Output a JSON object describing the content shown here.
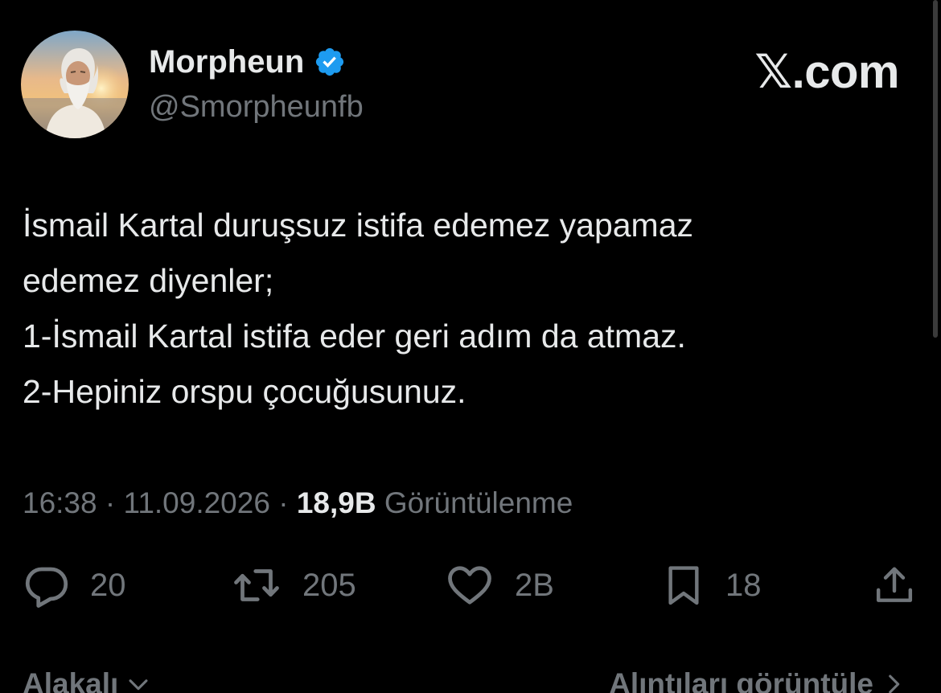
{
  "author": {
    "display_name": "Morpheun",
    "handle": "@Smorpheunfb",
    "verified": true
  },
  "brand": "𝕏.com",
  "tweet": {
    "lines": [
      "İsmail Kartal duruşsuz istifa edemez yapamaz",
      "edemez diyenler;",
      "1-İsmail Kartal istifa eder geri adım da atmaz.",
      "2-Hepiniz orspu çocuğusunuz."
    ]
  },
  "meta": {
    "time": "16:38",
    "separator": "·",
    "date": "11.09.2026",
    "views_count": "18,9B",
    "views_label": "Görüntülenme"
  },
  "actions": {
    "replies": "20",
    "reposts": "205",
    "likes": "2B",
    "bookmarks": "18"
  },
  "bottom": {
    "relevant_label": "Alakalı",
    "quotes_label": "Alıntıları görüntüle"
  },
  "colors": {
    "background": "#000000",
    "primary_text": "#e7e9ea",
    "secondary_text": "#71767b",
    "verified_badge": "#1d9bf0"
  },
  "icons": {
    "verified": "verified-badge-icon",
    "reply": "reply-bubble-icon",
    "repost": "repost-arrows-icon",
    "like": "heart-icon",
    "bookmark": "bookmark-icon",
    "share": "share-upload-icon",
    "relevant_dropdown": "chevron-down-icon",
    "quotes_arrow": "chevron-right-icon"
  }
}
